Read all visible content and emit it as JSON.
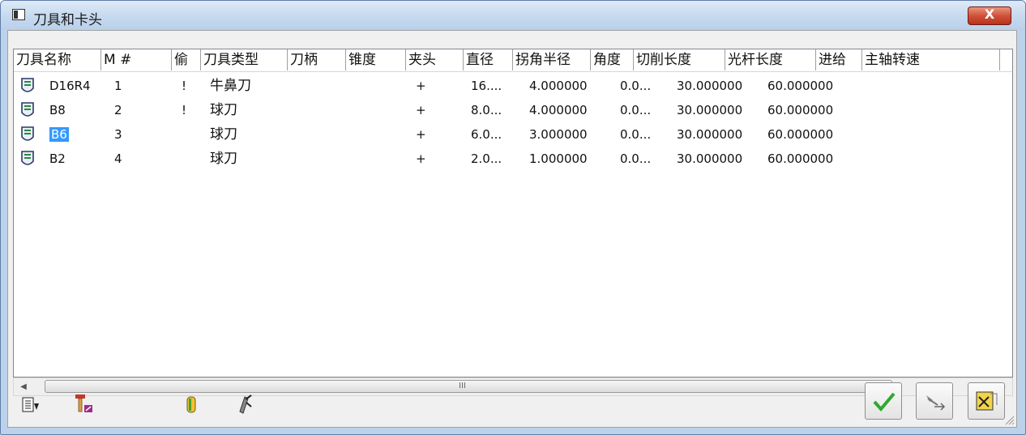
{
  "window": {
    "title": "刀具和卡头",
    "close_label": "X"
  },
  "table": {
    "columns": [
      {
        "key": "name",
        "label": "刀具名称"
      },
      {
        "key": "m",
        "label": "M #"
      },
      {
        "key": "flag",
        "label": "偷"
      },
      {
        "key": "type",
        "label": "刀具类型"
      },
      {
        "key": "holder",
        "label": "刀柄"
      },
      {
        "key": "taper",
        "label": "锥度"
      },
      {
        "key": "chuck",
        "label": "夹头"
      },
      {
        "key": "diameter",
        "label": "直径"
      },
      {
        "key": "corner",
        "label": "拐角半径"
      },
      {
        "key": "angle",
        "label": "角度"
      },
      {
        "key": "cutlen",
        "label": "切削长度"
      },
      {
        "key": "shanklen",
        "label": "光杆长度"
      },
      {
        "key": "feed",
        "label": "进给"
      },
      {
        "key": "spindle",
        "label": "主轴转速"
      }
    ],
    "rows": [
      {
        "name": "D16R4",
        "m": "1",
        "flag": "!",
        "type": "牛鼻刀",
        "chuck": "+",
        "diameter": "16....",
        "corner": "4.000000",
        "angle": "0.0...",
        "cutlen": "30.000000",
        "shanklen": "60.000000",
        "selected": false
      },
      {
        "name": "B8",
        "m": "2",
        "flag": "!",
        "type": "球刀",
        "chuck": "+",
        "diameter": "8.0...",
        "corner": "4.000000",
        "angle": "0.0...",
        "cutlen": "30.000000",
        "shanklen": "60.000000",
        "selected": false
      },
      {
        "name": "B6",
        "m": "3",
        "flag": "",
        "type": "球刀",
        "chuck": "+",
        "diameter": "6.0...",
        "corner": "3.000000",
        "angle": "0.0...",
        "cutlen": "30.000000",
        "shanklen": "60.000000",
        "selected": true
      },
      {
        "name": "B2",
        "m": "4",
        "flag": "",
        "type": "球刀",
        "chuck": "+",
        "diameter": "2.0...",
        "corner": "1.000000",
        "angle": "0.0...",
        "cutlen": "30.000000",
        "shanklen": "60.000000",
        "selected": false
      }
    ]
  },
  "scrollbar": {
    "grip": "III",
    "left_arrow": "◀",
    "right_arrow": "▶"
  },
  "toolbar": {
    "left": [
      "import-list-icon",
      "new-tool-icon",
      "chuck-icon",
      "delete-tool-icon"
    ],
    "right": [
      "ok-check-icon",
      "transfer-icon",
      "edit-list-icon"
    ]
  },
  "colors": {
    "selection": "#3399ff",
    "ok_green": "#2fa82f"
  }
}
